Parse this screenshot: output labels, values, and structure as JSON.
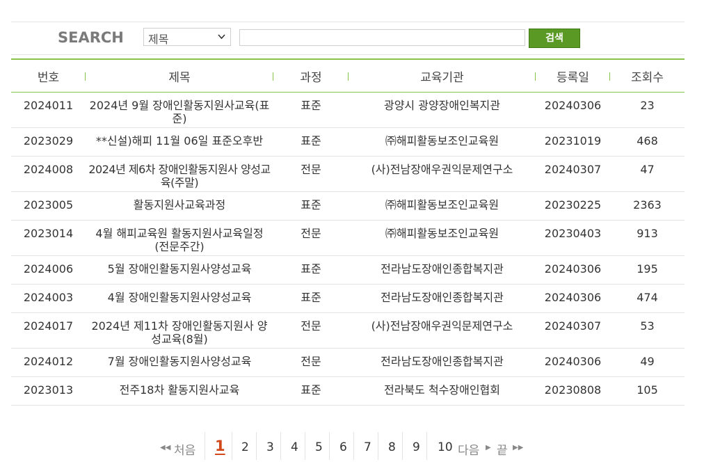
{
  "search": {
    "title": "SEARCH",
    "field_selected": "제목",
    "query_value": "",
    "button_label": "검색"
  },
  "table": {
    "headers": [
      "번호",
      "제목",
      "과정",
      "교육기관",
      "등록일",
      "조회수"
    ],
    "rows": [
      {
        "no": "2024011",
        "title": "2024년 9월 장애인활동지원사교육(표준)",
        "course": "표준",
        "org": "광양시 광양장애인복지관",
        "date": "20240306",
        "views": "23"
      },
      {
        "no": "2023029",
        "title": "**신설)해피 11월 06일 표준오후반",
        "course": "표준",
        "org": "㈜해피활동보조인교육원",
        "date": "20231019",
        "views": "468"
      },
      {
        "no": "2024008",
        "title": "2024년 제6차 장애인활동지원사 양성교육(주말)",
        "course": "전문",
        "org": "(사)전남장애우권익문제연구소",
        "date": "20240307",
        "views": "47"
      },
      {
        "no": "2023005",
        "title": "활동지원사교육과정",
        "course": "표준",
        "org": "㈜해피활동보조인교육원",
        "date": "20230225",
        "views": "2363"
      },
      {
        "no": "2023014",
        "title": "4월 해피교육원 활동지원사교육일정(전문주간)",
        "course": "전문",
        "org": "㈜해피활동보조인교육원",
        "date": "20230403",
        "views": "913"
      },
      {
        "no": "2024006",
        "title": "5월 장애인활동지원사양성교육",
        "course": "표준",
        "org": "전라남도장애인종합복지관",
        "date": "20240306",
        "views": "195"
      },
      {
        "no": "2024003",
        "title": "4월 장애인활동지원사양성교육",
        "course": "표준",
        "org": "전라남도장애인종합복지관",
        "date": "20240306",
        "views": "474"
      },
      {
        "no": "2024017",
        "title": "2024년 제11차 장애인활동지원사 양성교육(8월)",
        "course": "전문",
        "org": "(사)전남장애우권익문제연구소",
        "date": "20240307",
        "views": "53"
      },
      {
        "no": "2024012",
        "title": "7월 장애인활동지원사양성교육",
        "course": "전문",
        "org": "전라남도장애인종합복지관",
        "date": "20240306",
        "views": "49"
      },
      {
        "no": "2023013",
        "title": "전주18차 활동지원사교육",
        "course": "표준",
        "org": "전라북도 척수장애인협회",
        "date": "20230808",
        "views": "105"
      }
    ]
  },
  "pagination": {
    "first_label": "처음",
    "pages": [
      "1",
      "2",
      "3",
      "4",
      "5",
      "6",
      "7",
      "8",
      "9",
      "10"
    ],
    "current": "1",
    "next_label": "다음",
    "last_label": "끝"
  },
  "colors": {
    "accent_green": "#8bc34a",
    "button_green": "#5a9a24",
    "current_page": "#d2481a"
  }
}
